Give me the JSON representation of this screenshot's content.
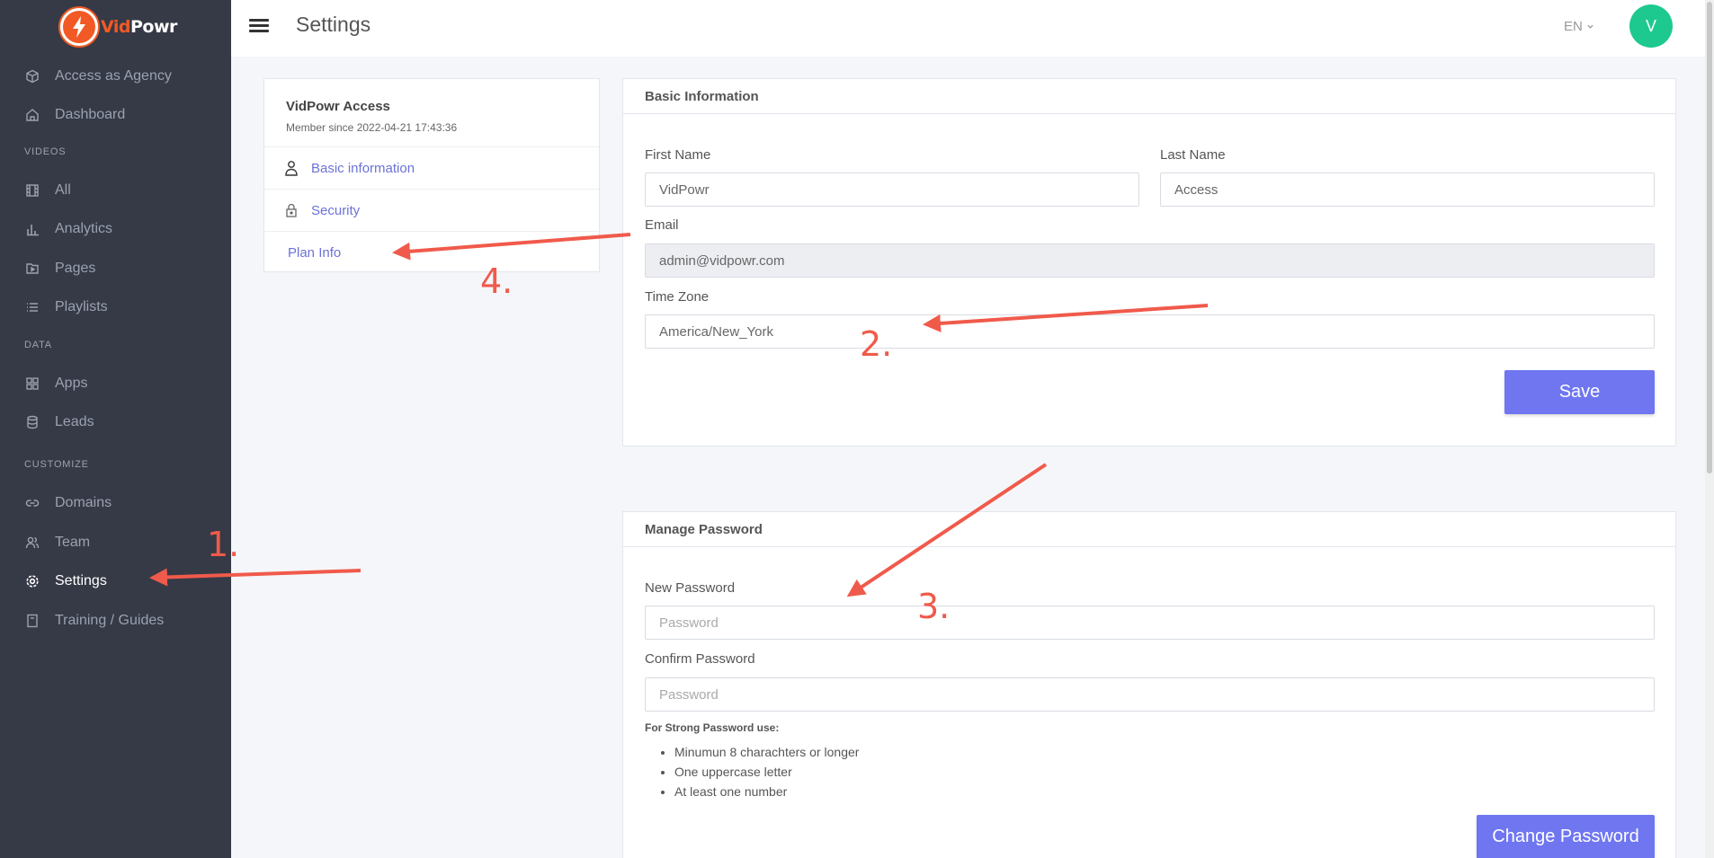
{
  "brand": {
    "vid": "Vid",
    "powr": "Powr",
    "accent": "#f15a24"
  },
  "sidebar": {
    "items": [
      {
        "label": "Access as Agency",
        "icon": "cube-icon"
      },
      {
        "label": "Dashboard",
        "icon": "home-icon"
      },
      {
        "label": "All",
        "icon": "film-icon"
      },
      {
        "label": "Analytics",
        "icon": "bar-chart-icon"
      },
      {
        "label": "Pages",
        "icon": "file-play-icon"
      },
      {
        "label": "Playlists",
        "icon": "list-icon"
      },
      {
        "label": "Apps",
        "icon": "grid-icon"
      },
      {
        "label": "Leads",
        "icon": "database-icon"
      },
      {
        "label": "Domains",
        "icon": "link-icon"
      },
      {
        "label": "Team",
        "icon": "users-icon"
      },
      {
        "label": "Settings",
        "icon": "gear-icon",
        "active": true
      },
      {
        "label": "Training / Guides",
        "icon": "book-icon"
      }
    ],
    "sections": [
      "VIDEOS",
      "DATA",
      "CUSTOMIZE"
    ]
  },
  "topbar": {
    "title": "Settings",
    "language": "EN",
    "avatar_initial": "V"
  },
  "profile": {
    "name": "VidPowr Access",
    "member_since": "Member since 2022-04-21 17:43:36",
    "links": [
      "Basic information",
      "Security",
      "Plan Info"
    ]
  },
  "basic_info": {
    "header": "Basic Information",
    "first_name_label": "First Name",
    "first_name_value": "VidPowr",
    "last_name_label": "Last Name",
    "last_name_value": "Access",
    "email_label": "Email",
    "email_value": "admin@vidpowr.com",
    "timezone_label": "Time Zone",
    "timezone_value": "America/New_York",
    "save_label": "Save"
  },
  "password": {
    "header": "Manage Password",
    "new_label": "New Password",
    "new_placeholder": "Password",
    "confirm_label": "Confirm Password",
    "confirm_placeholder": "Password",
    "hint_title": "For Strong Password use:",
    "hints": [
      "Minumun 8 charachters or longer",
      "One uppercase letter",
      "At least one number"
    ],
    "button_label": "Change Password"
  },
  "annotations": {
    "step1": "1.",
    "step2": "2.",
    "step3": "3.",
    "step4": "4.",
    "color": "#f05a4b"
  },
  "colors": {
    "sidebar_bg": "#363a46",
    "primary": "#6f76f0",
    "avatar": "#1dc98f",
    "link": "#6c72d8"
  }
}
